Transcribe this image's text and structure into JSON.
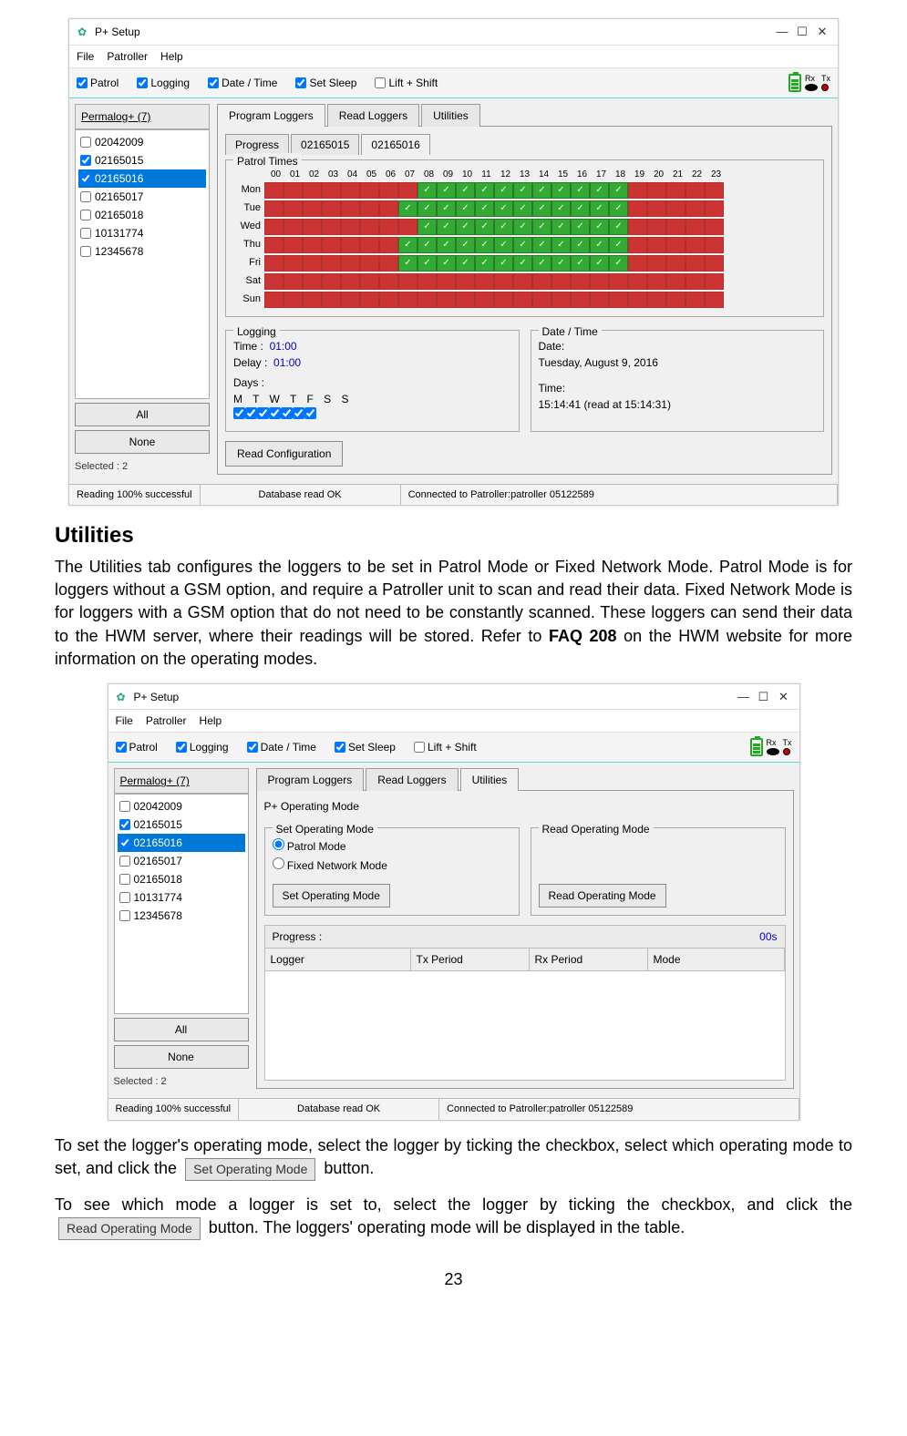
{
  "screenshot1": {
    "window_title": "P+ Setup",
    "menu": [
      "File",
      "Patroller",
      "Help"
    ],
    "toolbar": [
      {
        "label": "Patrol",
        "checked": true
      },
      {
        "label": "Logging",
        "checked": true
      },
      {
        "label": "Date / Time",
        "checked": true
      },
      {
        "label": "Set Sleep",
        "checked": true
      },
      {
        "label": "Lift + Shift",
        "checked": false
      }
    ],
    "rx_label": "Rx",
    "tx_label": "Tx",
    "permalog_header": "Permalog+ (7)",
    "loggers": [
      {
        "id": "02042009",
        "checked": false,
        "selected": false
      },
      {
        "id": "02165015",
        "checked": true,
        "selected": false
      },
      {
        "id": "02165016",
        "checked": true,
        "selected": true
      },
      {
        "id": "02165017",
        "checked": false,
        "selected": false
      },
      {
        "id": "02165018",
        "checked": false,
        "selected": false
      },
      {
        "id": "10131774",
        "checked": false,
        "selected": false
      },
      {
        "id": "12345678",
        "checked": false,
        "selected": false
      }
    ],
    "btn_all": "All",
    "btn_none": "None",
    "selected_label": "Selected : 2",
    "tabs": [
      "Program Loggers",
      "Read Loggers",
      "Utilities"
    ],
    "active_tab": 0,
    "progress_tabs_label": "Progress",
    "progress_tabs": [
      "02165015",
      "02165016"
    ],
    "patrol_times_title": "Patrol Times",
    "hours": [
      "00",
      "01",
      "02",
      "03",
      "04",
      "05",
      "06",
      "07",
      "08",
      "09",
      "10",
      "11",
      "12",
      "13",
      "14",
      "15",
      "16",
      "17",
      "18",
      "19",
      "20",
      "21",
      "22",
      "23"
    ],
    "days": [
      "Mon",
      "Tue",
      "Wed",
      "Thu",
      "Fri",
      "Sat",
      "Sun"
    ],
    "pattern": [
      [
        0,
        0,
        0,
        0,
        0,
        0,
        0,
        0,
        1,
        1,
        1,
        1,
        1,
        1,
        1,
        1,
        1,
        1,
        1,
        0,
        0,
        0,
        0,
        0
      ],
      [
        0,
        0,
        0,
        0,
        0,
        0,
        0,
        1,
        1,
        1,
        1,
        1,
        1,
        1,
        1,
        1,
        1,
        1,
        1,
        0,
        0,
        0,
        0,
        0
      ],
      [
        0,
        0,
        0,
        0,
        0,
        0,
        0,
        0,
        1,
        1,
        1,
        1,
        1,
        1,
        1,
        1,
        1,
        1,
        1,
        0,
        0,
        0,
        0,
        0
      ],
      [
        0,
        0,
        0,
        0,
        0,
        0,
        0,
        1,
        1,
        1,
        1,
        1,
        1,
        1,
        1,
        1,
        1,
        1,
        1,
        0,
        0,
        0,
        0,
        0
      ],
      [
        0,
        0,
        0,
        0,
        0,
        0,
        0,
        1,
        1,
        1,
        1,
        1,
        1,
        1,
        1,
        1,
        1,
        1,
        1,
        0,
        0,
        0,
        0,
        0
      ],
      [
        0,
        0,
        0,
        0,
        0,
        0,
        0,
        0,
        0,
        0,
        0,
        0,
        0,
        0,
        0,
        0,
        0,
        0,
        0,
        0,
        0,
        0,
        0,
        0
      ],
      [
        0,
        0,
        0,
        0,
        0,
        0,
        0,
        0,
        0,
        0,
        0,
        0,
        0,
        0,
        0,
        0,
        0,
        0,
        0,
        0,
        0,
        0,
        0,
        0
      ]
    ],
    "logging_group": "Logging",
    "time_label": "Time :",
    "time_value": "01:00",
    "delay_label": "Delay :",
    "delay_value": "01:00",
    "days_label": "Days :",
    "days_hdr": "M  T  W  T  F  S  S",
    "datetime_group": "Date / Time",
    "date_label": "Date:",
    "date_value": "Tuesday, August 9, 2016",
    "time2_label": "Time:",
    "time2_value": "15:14:41 (read at 15:14:31)",
    "read_config_btn": "Read Configuration",
    "status_left": "Reading 100% successful",
    "status_mid": "Database read OK",
    "status_right": "Connected to Patroller:patroller 05122589"
  },
  "doc": {
    "heading": "Utilities",
    "para1": "The Utilities tab configures the loggers to be set in Patrol Mode or Fixed Network Mode. Patrol Mode is for loggers without a GSM option, and require a Patroller unit to scan and read their data. Fixed Network Mode is for loggers with a GSM option that do not need to be constantly scanned. These loggers can send their data to the HWM server, where their readings will be stored. Refer to ",
    "para1_bold": "FAQ 208",
    "para1_tail": " on the HWM website for more information on the operating modes.",
    "para2a": "To set the logger's operating mode, select the logger by ticking the checkbox, select which operating mode to set, and click the ",
    "btn_set": "Set Operating Mode",
    "para2b": " button.",
    "para3a": "To see which mode a logger is set to, select the logger by ticking the checkbox, and click the ",
    "btn_read": "Read Operating Mode",
    "para3b": " button. The loggers' operating mode will be displayed in the table.",
    "page_number": "23"
  },
  "screenshot2": {
    "window_title": "P+ Setup",
    "menu": [
      "File",
      "Patroller",
      "Help"
    ],
    "permalog_header": "Permalog+ (7)",
    "toolbar": [
      {
        "label": "Patrol",
        "checked": true
      },
      {
        "label": "Logging",
        "checked": true
      },
      {
        "label": "Date / Time",
        "checked": true
      },
      {
        "label": "Set Sleep",
        "checked": true
      },
      {
        "label": "Lift + Shift",
        "checked": false
      }
    ],
    "tabs": [
      "Program Loggers",
      "Read Loggers",
      "Utilities"
    ],
    "active_tab": 2,
    "op_mode_header": "P+ Operating Mode",
    "set_op_group": "Set Operating Mode",
    "read_op_group": "Read Operating Mode",
    "radio_patrol": "Patrol Mode",
    "radio_fixed": "Fixed Network Mode",
    "set_op_btn": "Set Operating Mode",
    "read_op_btn": "Read Operating Mode",
    "progress_label": "Progress :",
    "progress_time": "00s",
    "cols": [
      "Logger",
      "Tx Period",
      "Rx Period",
      "Mode"
    ],
    "loggers": [
      {
        "id": "02042009",
        "checked": false,
        "selected": false
      },
      {
        "id": "02165015",
        "checked": true,
        "selected": false
      },
      {
        "id": "02165016",
        "checked": true,
        "selected": true
      },
      {
        "id": "02165017",
        "checked": false,
        "selected": false
      },
      {
        "id": "02165018",
        "checked": false,
        "selected": false
      },
      {
        "id": "10131774",
        "checked": false,
        "selected": false
      },
      {
        "id": "12345678",
        "checked": false,
        "selected": false
      }
    ],
    "btn_all": "All",
    "btn_none": "None",
    "selected_label": "Selected : 2",
    "status_left": "Reading 100% successful",
    "status_mid": "Database read OK",
    "status_right": "Connected to Patroller:patroller 05122589"
  }
}
